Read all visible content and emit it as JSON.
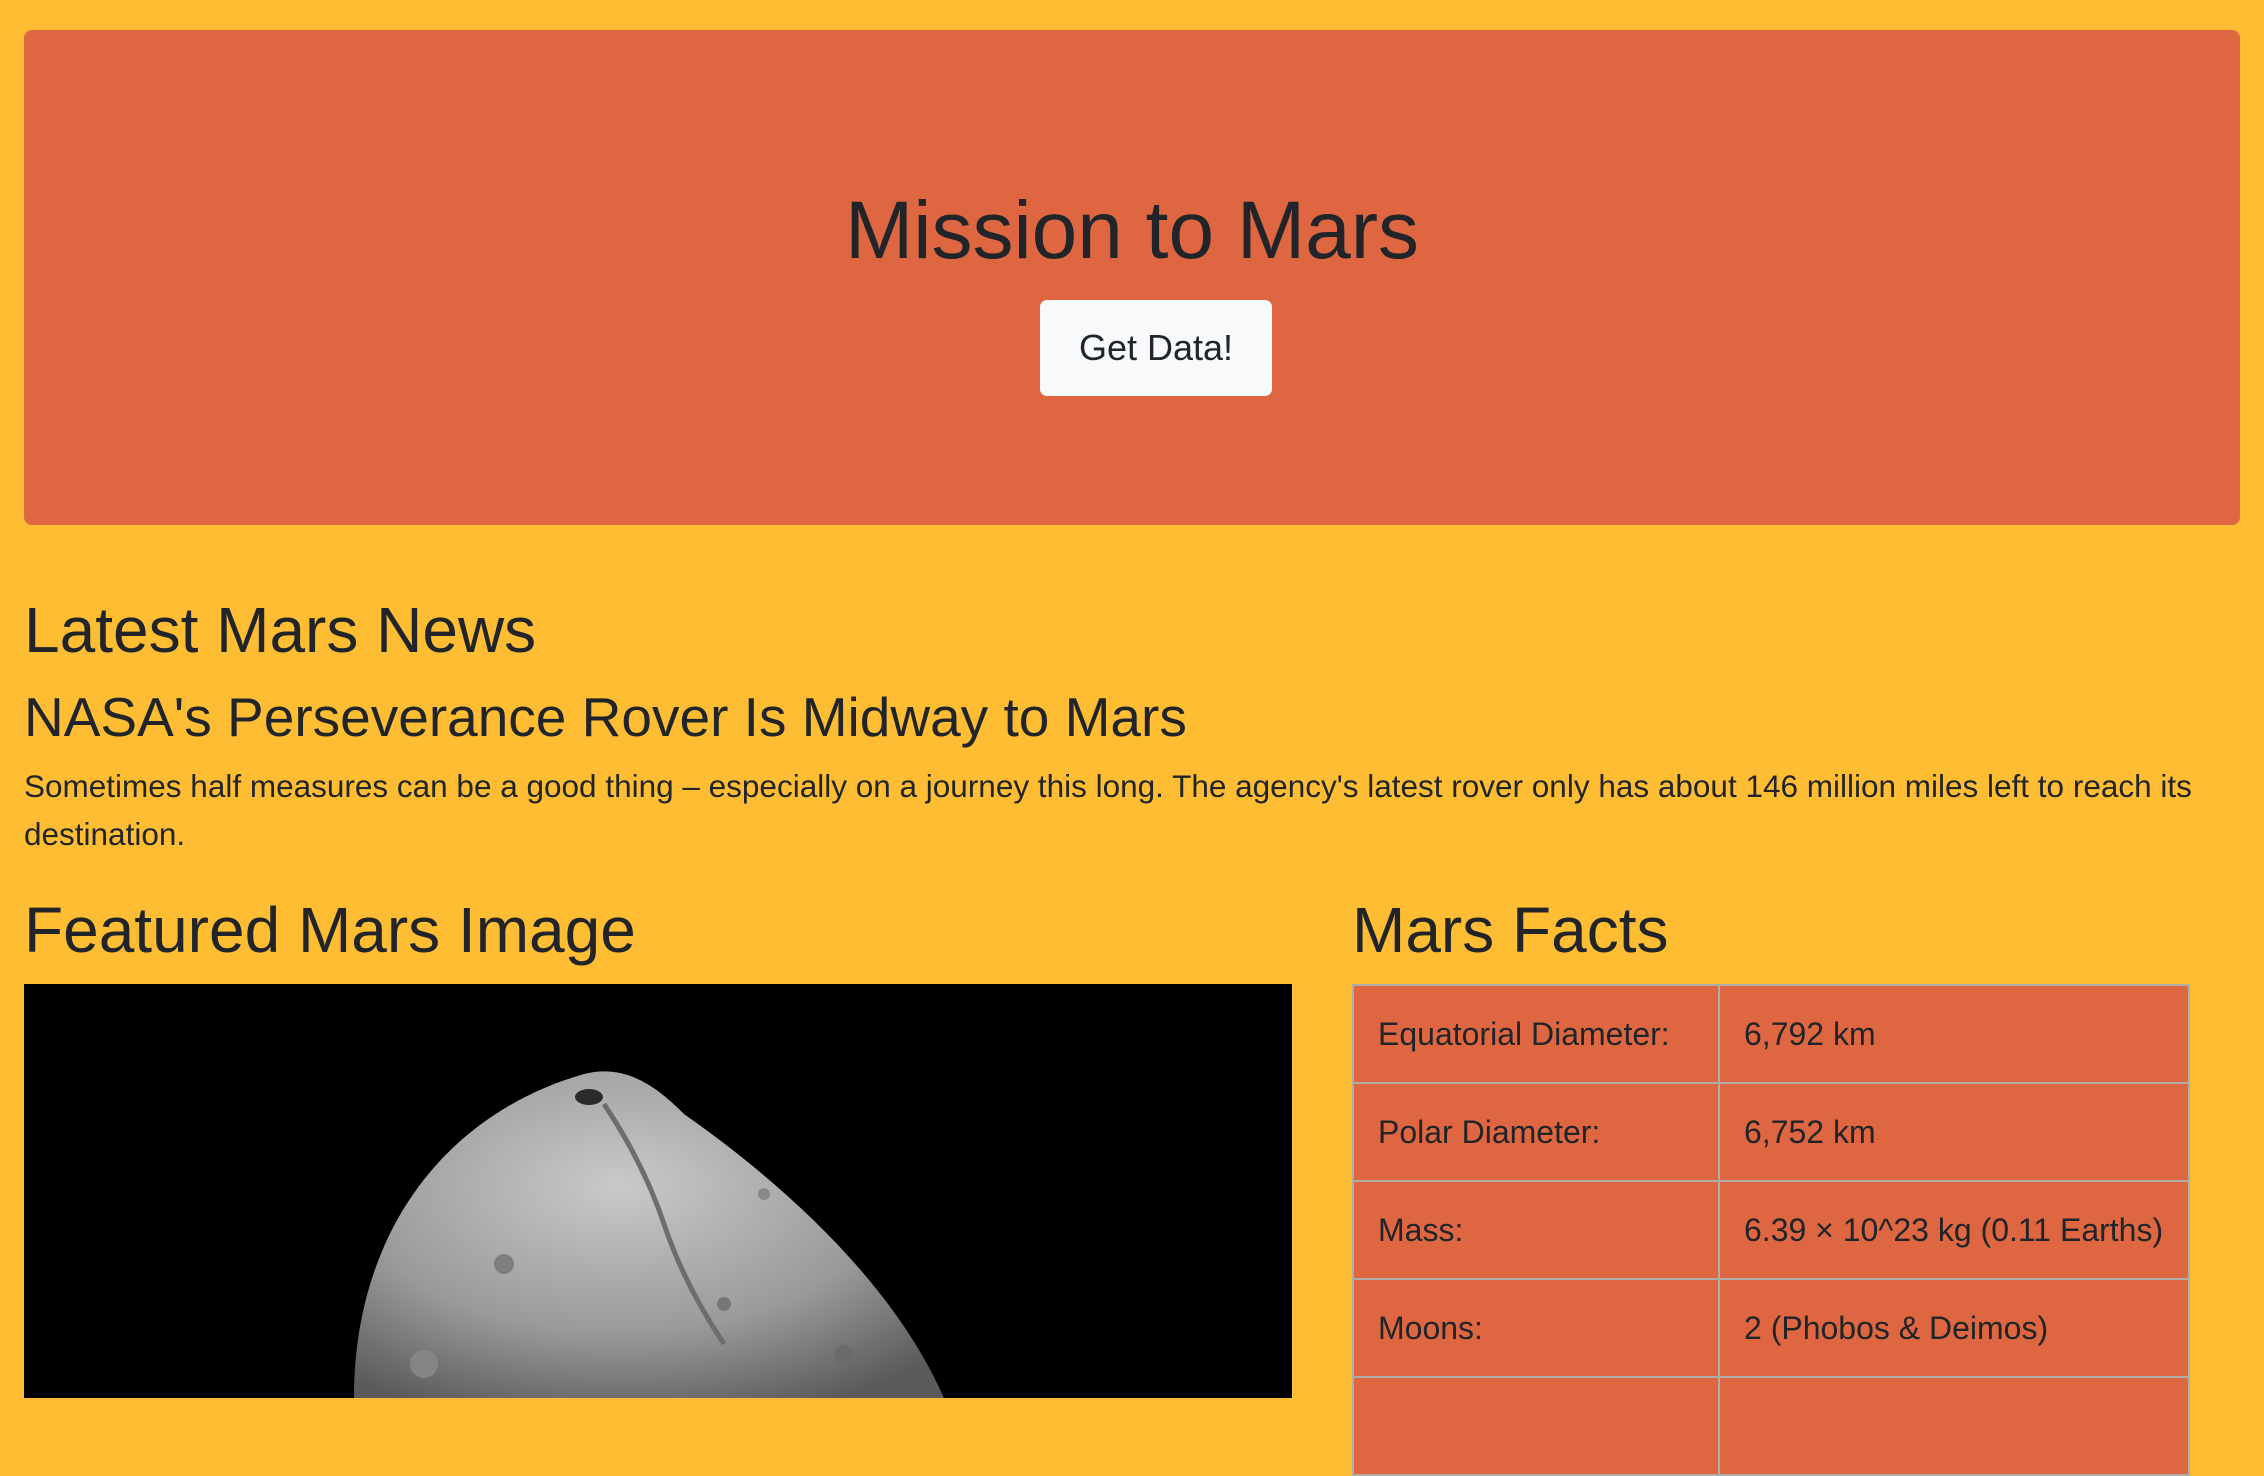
{
  "header": {
    "title": "Mission to Mars",
    "button_label": "Get Data!"
  },
  "news": {
    "section_title": "Latest Mars News",
    "headline": "NASA's Perseverance Rover Is Midway to Mars",
    "teaser": "Sometimes half measures can be a good thing – especially on a journey this long. The agency's latest rover only has about 146 million miles left to reach its destination."
  },
  "featured_image": {
    "section_title": "Featured Mars Image"
  },
  "facts": {
    "section_title": "Mars Facts",
    "rows": [
      {
        "label": "Equatorial Diameter:",
        "value": "6,792 km"
      },
      {
        "label": "Polar Diameter:",
        "value": "6,752 km"
      },
      {
        "label": "Mass:",
        "value": "6.39 × 10^23 kg (0.11 Earths)"
      },
      {
        "label": "Moons:",
        "value": "2 (Phobos & Deimos)"
      },
      {
        "label": "",
        "value": ""
      }
    ]
  },
  "colors": {
    "page_background": "#FEBD33",
    "jumbotron": "#DE6742",
    "button": "#F8F9FA",
    "text": "#212529"
  }
}
